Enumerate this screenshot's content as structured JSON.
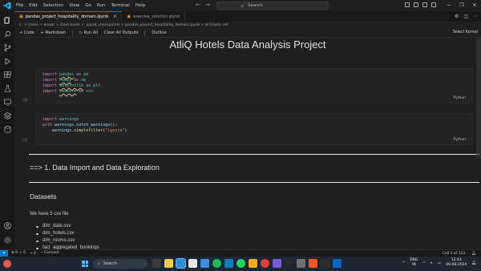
{
  "menu": [
    "File",
    "Edit",
    "Selection",
    "View",
    "Go",
    "Run",
    "Terminal",
    "Help"
  ],
  "search": {
    "text": "Search"
  },
  "tabs": [
    {
      "label": "pandas_project_hospitality_domain.ipynb",
      "active": true
    },
    {
      "label": "exercise_solution.ipynb",
      "active": false
    }
  ],
  "breadcrumb": "C: > Users > waqar > Downloads > .ipynb_checkpoints > pandas_project_hospitality_domain.ipynb > ⊕ Empty cell",
  "toolbar": {
    "code": "+ Code",
    "markdown": "+ Markdown",
    "run_all": "▷ Run All",
    "clear_outputs": "Clear All Outputs",
    "outline": "Outline",
    "kernel": "Select Kernel"
  },
  "notebook": {
    "title": "AtliQ Hotels Data Analysis Project",
    "cell1": {
      "exec": "[1]",
      "lang": "Python",
      "lines": [
        {
          "kw": "import",
          "mod": "pandas",
          "as": "as",
          "alias": "pd"
        },
        {
          "kw": "import",
          "mod": "numpy",
          "as": "as",
          "alias": "np"
        },
        {
          "kw": "import",
          "mod": "matplotlib",
          "as": "as",
          "alias": "plt"
        },
        {
          "kw": "import",
          "mod": "seaborn",
          "as": "as",
          "alias": "sns"
        }
      ]
    },
    "cell2": {
      "exec": "[1]",
      "lang": "Python",
      "line1_kw": "import",
      "line1_mod": "warnings",
      "line2_kw": "with",
      "line2_rest": "warnings.catch_warnings():",
      "line3_obj": "warnings.",
      "line3_fn": "simplefilter",
      "line3_arg": "\"ignore\""
    },
    "section_heading": "==> 1. Data Import and Data Exploration",
    "datasets_heading": "Datasets",
    "datasets_text": "We have 5 csv file",
    "files": [
      "dim_date.csv",
      "dim_hotels.csv",
      "dim_rooms.csv",
      "fact_aggregated_bookings"
    ]
  },
  "statusbar": {
    "problems": "⊗ 0 ⚠ 0",
    "ports": "⑂ 0",
    "connect": "⌁ Connect",
    "cell_position": "Cell 1 of 123"
  },
  "taskbar": {
    "search": "Search",
    "lang": "ENG",
    "region": "IN",
    "time": "12:43",
    "date": "09-08-2024"
  },
  "colors": {
    "accent": "#0078d4",
    "editor_bg": "#1f1f1f",
    "taskbar_bg": "#1c2733"
  }
}
